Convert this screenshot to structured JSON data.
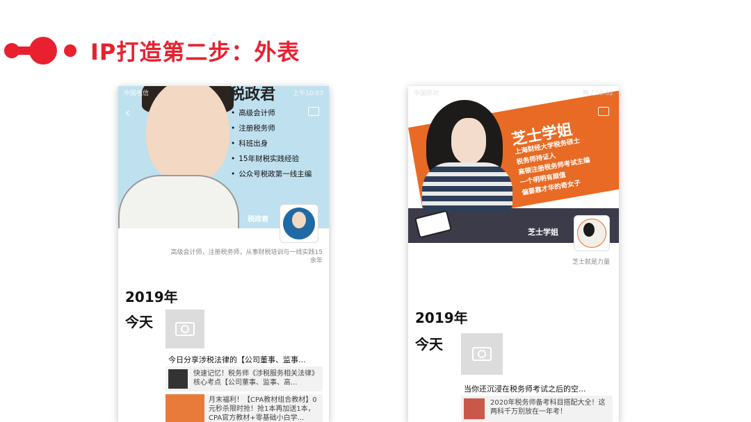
{
  "header": {
    "title": "IP打造第二步：外表"
  },
  "phone1": {
    "status_left": "中国电信",
    "status_right": "上午10:03",
    "cover_sign": "税政君",
    "bullets": [
      "高级会计师",
      "注册税务师",
      "科班出身",
      "15年财税实践经验",
      "公众号税政第一线主编"
    ],
    "nick": "税政君",
    "avatar_label": "税政君",
    "bio": "高级会计师，注册税务师，从事财税培训与一线实践15余年",
    "year": "2019年",
    "today": "今天",
    "share_title": "今日分享涉税法律的【公司董事、监事...",
    "cards": [
      {
        "text": "快速记忆！税务师《涉税服务相关法律》核心考点【公司董事、监事、高..."
      },
      {
        "text": "月末福利！【CPA教材组合教材】0元秒杀限时抢！抢1本再加送1本，CPA官方教材+零基础小白学..."
      }
    ]
  },
  "phone2": {
    "status_left": "中国移动",
    "status_right": "晚上10:02",
    "cover_title": "芝士学姐",
    "cover_lines": [
      "上海财经大学税务硕士",
      "税务师持证人",
      "高顿注册税务师考试主编",
      "一个明明有颜值",
      "偏要靠才华的奇女子"
    ],
    "nick": "芝士学姐",
    "avatar_label": "芝士学姐",
    "bio": "芝士就是力量",
    "year": "2019年",
    "today": "今天",
    "share_title": "当你还沉浸在税务师考试之后的空...",
    "cards": [
      {
        "text": "2020年税务师备考科目搭配大全！这两科千万别放在一年考！"
      }
    ]
  },
  "colors": {
    "accent": "#e8202f",
    "phone1_cover": "#bfe0ef",
    "phone2_cover": "#e86a24"
  }
}
